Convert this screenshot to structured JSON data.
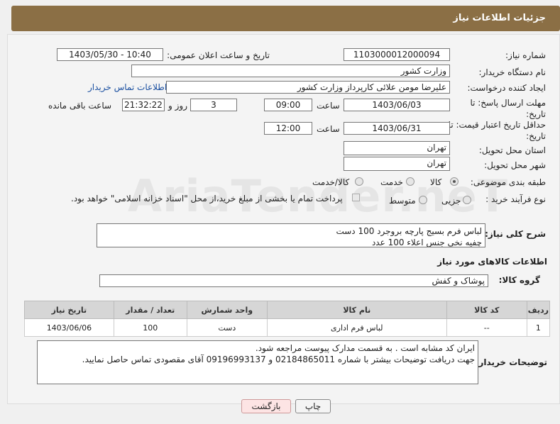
{
  "header": {
    "title": "جزئیات اطلاعات نیاز"
  },
  "watermark": "AriaTender.neT",
  "fields": {
    "need_number": {
      "label": "شماره نیاز:",
      "value": "1103000012000094"
    },
    "announce_datetime": {
      "label": "تاریخ و ساعت اعلان عمومی:",
      "value": "1403/05/30 - 10:40"
    },
    "buyer_org": {
      "label": "نام دستگاه خریدار:",
      "value": "وزارت کشور"
    },
    "requester": {
      "label": "ایجاد کننده درخواست:",
      "value": "علیرضا مومن علائی کارپرداز وزارت کشور",
      "contact_link": "اطلاعات تماس خریدار"
    },
    "reply_deadline": {
      "label": "مهلت ارسال پاسخ: تا تاریخ:",
      "date": "1403/06/03",
      "time_label": "ساعت",
      "time": "09:00",
      "days": "3",
      "days_label": "روز و",
      "remaining": "21:32:22",
      "remaining_label": "ساعت باقی مانده"
    },
    "price_validity": {
      "label": "حداقل تاریخ اعتبار قیمت: تا تاریخ:",
      "date": "1403/06/31",
      "time_label": "ساعت",
      "time": "12:00"
    },
    "province": {
      "label": "استان محل تحویل:",
      "value": "تهران"
    },
    "city": {
      "label": "شهر محل تحویل:",
      "value": "تهران"
    },
    "category": {
      "label": "طبقه بندی موضوعی:",
      "options": [
        "کالا",
        "خدمت",
        "کالا/خدمت"
      ],
      "selected": "کالا"
    },
    "purchase_type": {
      "label": "نوع فرآیند خرید :",
      "options": [
        "جزیی",
        "متوسط"
      ],
      "note": "پرداخت تمام یا بخشی از مبلغ خرید،از محل \"اسناد خزانه اسلامی\" خواهد بود."
    }
  },
  "description": {
    "label": "شرح کلی نیاز:",
    "line1": "لباس فرم بسیج پارچه بروجرد 100 دست",
    "line2": "چفیه نخی جنس اعلاء 100 عدد"
  },
  "goods_info": {
    "title": "اطلاعات کالاهای مورد نیاز"
  },
  "goods_group": {
    "label": "گروه کالا:",
    "value": "پوشاک و کفش"
  },
  "table": {
    "headers": [
      "ردیف",
      "کد کالا",
      "نام کالا",
      "واحد شمارش",
      "تعداد / مقدار",
      "تاریخ نیاز"
    ],
    "rows": [
      {
        "row": "1",
        "code": "--",
        "name": "لباس فرم اداری",
        "unit": "دست",
        "qty": "100",
        "date": "1403/06/06"
      }
    ]
  },
  "buyer_notes": {
    "label": "توضیحات خریدار:",
    "line1": "ایران کد مشابه است . به قسمت مدارک پیوست مراجعه شود.",
    "line2": "جهت دریافت توضیحات بیشتر با شماره 02184865011 و 09196993137 آقای مقصودی تماس حاصل نمایید."
  },
  "buttons": {
    "print": "چاپ",
    "back": "بازگشت"
  }
}
